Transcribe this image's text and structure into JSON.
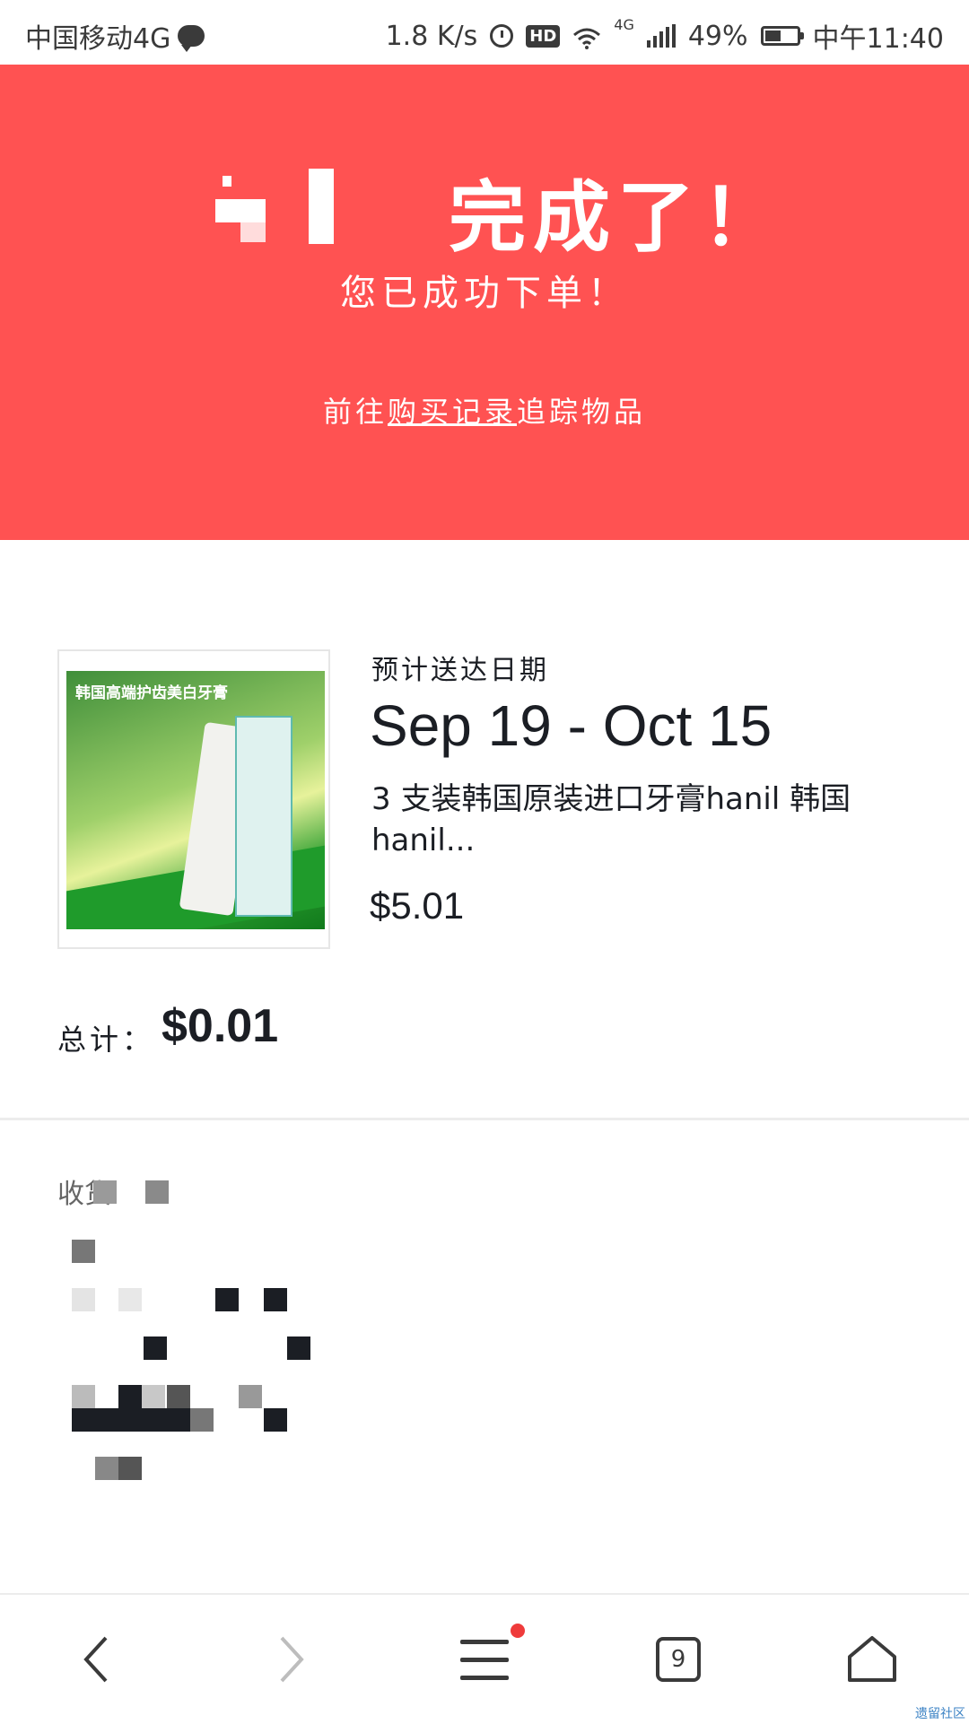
{
  "status_bar": {
    "carrier": "中国移动4G",
    "speed": "1.8 K/s",
    "hd": "HD",
    "network": "4G",
    "battery": "49%",
    "time": "中午11:40"
  },
  "banner": {
    "title": "完成了！",
    "subtitle": "您已成功下单！",
    "link_prefix": "前往",
    "link_text": "购买记录",
    "link_suffix": "追踪物品"
  },
  "order": {
    "image_text": "韩国高端护齿美白牙膏",
    "delivery_label": "预计送达日期",
    "delivery_dates": "Sep 19 - Oct 15",
    "product_name": "3 支装韩国原装进口牙膏hanil 韩国 hanil...",
    "price": "$5.01",
    "total_label": "总计：",
    "total_value": "$0.01"
  },
  "shipping": {
    "heading": "收货"
  },
  "nav": {
    "back": "‹",
    "forward": "›",
    "tabs_count": "9"
  },
  "watermark": "遗留社区",
  "colors": {
    "banner": "#ff5252",
    "text": "#1b1e24",
    "badge": "#ef3b3b"
  }
}
